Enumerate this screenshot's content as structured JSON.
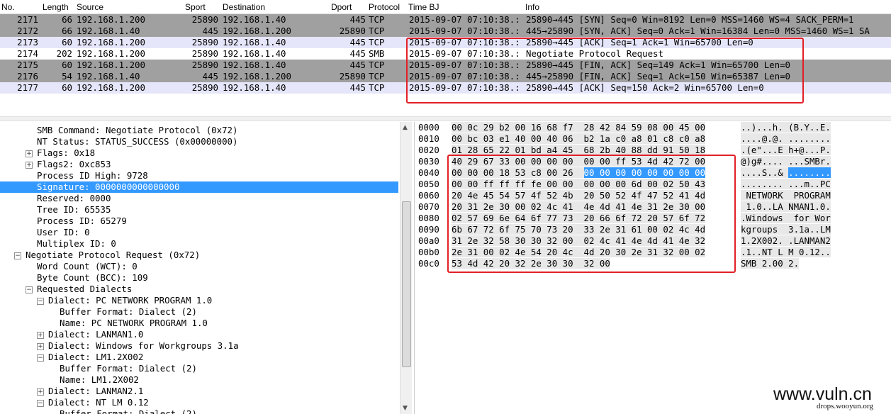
{
  "packet_list": {
    "columns": [
      "No.",
      "Length",
      "Source",
      "Sport",
      "Destination",
      "Dport",
      "Protocol",
      "Time BJ",
      "Info"
    ],
    "rows": [
      {
        "no": "2171",
        "length": "66",
        "source": "192.168.1.200",
        "sport": "25890",
        "destination": "192.168.1.40",
        "dport": "445",
        "protocol": "TCP",
        "time": "2015-09-07 07:10:38.:",
        "info": "25890→445 [SYN] Seq=0 Win=8192 Len=0 MSS=1460 WS=4 SACK_PERM=1"
      },
      {
        "no": "2172",
        "length": "66",
        "source": "192.168.1.40",
        "sport": "445",
        "destination": "192.168.1.200",
        "dport": "25890",
        "protocol": "TCP",
        "time": "2015-09-07 07:10:38.:",
        "info": "445→25890 [SYN, ACK] Seq=0 Ack=1 Win=16384 Len=0 MSS=1460 WS=1 SA"
      },
      {
        "no": "2173",
        "length": "60",
        "source": "192.168.1.200",
        "sport": "25890",
        "destination": "192.168.1.40",
        "dport": "445",
        "protocol": "TCP",
        "time": "2015-09-07 07:10:38.:",
        "info": "25890→445 [ACK] Seq=1 Ack=1 Win=65700 Len=0"
      },
      {
        "no": "2174",
        "length": "202",
        "source": "192.168.1.200",
        "sport": "25890",
        "destination": "192.168.1.40",
        "dport": "445",
        "protocol": "SMB",
        "time": "2015-09-07 07:10:38.:",
        "info": "Negotiate Protocol Request"
      },
      {
        "no": "2175",
        "length": "60",
        "source": "192.168.1.200",
        "sport": "25890",
        "destination": "192.168.1.40",
        "dport": "445",
        "protocol": "TCP",
        "time": "2015-09-07 07:10:38.:",
        "info": "25890→445 [FIN, ACK] Seq=149 Ack=1 Win=65700 Len=0"
      },
      {
        "no": "2176",
        "length": "54",
        "source": "192.168.1.40",
        "sport": "445",
        "destination": "192.168.1.200",
        "dport": "25890",
        "protocol": "TCP",
        "time": "2015-09-07 07:10:38.:",
        "info": "445→25890 [FIN, ACK] Seq=1 Ack=150 Win=65387 Len=0"
      },
      {
        "no": "2177",
        "length": "60",
        "source": "192.168.1.200",
        "sport": "25890",
        "destination": "192.168.1.40",
        "dport": "445",
        "protocol": "TCP",
        "time": "2015-09-07 07:10:38.:",
        "info": "25890→445 [ACK] Seq=150 Ack=2 Win=65700 Len=0"
      }
    ]
  },
  "detail_tree": {
    "lines": [
      {
        "text": "SMB Command: Negotiate Protocol (0x72)",
        "indent": 3,
        "toggle": ""
      },
      {
        "text": "NT Status: STATUS_SUCCESS (0x00000000)",
        "indent": 3,
        "toggle": ""
      },
      {
        "text": "Flags: 0x18",
        "indent": 3,
        "toggle": "+"
      },
      {
        "text": "Flags2: 0xc853",
        "indent": 3,
        "toggle": "+"
      },
      {
        "text": "Process ID High: 9728",
        "indent": 3,
        "toggle": ""
      },
      {
        "text": "Signature: 0000000000000000",
        "indent": 3,
        "toggle": "",
        "selected": true
      },
      {
        "text": "Reserved: 0000",
        "indent": 3,
        "toggle": ""
      },
      {
        "text": "Tree ID: 65535",
        "indent": 3,
        "toggle": ""
      },
      {
        "text": "Process ID: 65279",
        "indent": 3,
        "toggle": ""
      },
      {
        "text": "User ID: 0",
        "indent": 3,
        "toggle": ""
      },
      {
        "text": "Multiplex ID: 0",
        "indent": 3,
        "toggle": ""
      },
      {
        "text": "Negotiate Protocol Request (0x72)",
        "indent": 2,
        "toggle": "-"
      },
      {
        "text": "Word Count (WCT): 0",
        "indent": 3,
        "toggle": ""
      },
      {
        "text": "Byte Count (BCC): 109",
        "indent": 3,
        "toggle": ""
      },
      {
        "text": "Requested Dialects",
        "indent": 3,
        "toggle": "-"
      },
      {
        "text": "Dialect: PC NETWORK PROGRAM 1.0",
        "indent": 4,
        "toggle": "-"
      },
      {
        "text": "Buffer Format: Dialect (2)",
        "indent": 5,
        "toggle": ""
      },
      {
        "text": "Name: PC NETWORK PROGRAM 1.0",
        "indent": 5,
        "toggle": ""
      },
      {
        "text": "Dialect: LANMAN1.0",
        "indent": 4,
        "toggle": "+"
      },
      {
        "text": "Dialect: Windows for Workgroups 3.1a",
        "indent": 4,
        "toggle": "+"
      },
      {
        "text": "Dialect: LM1.2X002",
        "indent": 4,
        "toggle": "-"
      },
      {
        "text": "Buffer Format: Dialect (2)",
        "indent": 5,
        "toggle": ""
      },
      {
        "text": "Name: LM1.2X002",
        "indent": 5,
        "toggle": ""
      },
      {
        "text": "Dialect: LANMAN2.1",
        "indent": 4,
        "toggle": "+"
      },
      {
        "text": "Dialect: NT LM 0.12",
        "indent": 4,
        "toggle": "-"
      },
      {
        "text": "Buffer Format: Dialect (2)",
        "indent": 5,
        "toggle": ""
      }
    ]
  },
  "hex_dump": {
    "rows": [
      {
        "offset": "0000",
        "bytes": "00 0c 29 b2 00 16 68 f7  28 42 84 59 08 00 45 00",
        "ascii": "..)...h. (B.Y..E."
      },
      {
        "offset": "0010",
        "bytes": "00 bc 03 e1 40 00 40 06  b2 1a c0 a8 01 c8 c0 a8",
        "ascii": "....@.@. ........"
      },
      {
        "offset": "0020",
        "bytes": "01 28 65 22 01 bd a4 45  68 2b 40 88 dd 91 50 18",
        "ascii": ".(e\"...E h+@...P."
      },
      {
        "offset": "0030",
        "bytes": "40 29 67 33 00 00 00 00  00 00 ff 53 4d 42 72 00",
        "ascii": "@)g#.... ...SMBr."
      },
      {
        "offset": "0040",
        "bytes_pre": "00 00 00 18 53 c8 00 26  ",
        "bytes_hl": "00 00 00 00 00 00 00 00",
        "ascii_pre": "....S..& ",
        "ascii_hl": "........"
      },
      {
        "offset": "0050",
        "bytes": "00 00 ff ff ff fe 00 00  00 00 00 6d 00 02 50 43",
        "ascii": "........ ...m..PC"
      },
      {
        "offset": "0060",
        "bytes": "20 4e 45 54 57 4f 52 4b  20 50 52 4f 47 52 41 4d",
        "ascii": " NETWORK  PROGRAM"
      },
      {
        "offset": "0070",
        "bytes": "20 31 2e 30 00 02 4c 41  4e 4d 41 4e 31 2e 30 00",
        "ascii": " 1.0..LA NMAN1.0."
      },
      {
        "offset": "0080",
        "bytes": "02 57 69 6e 64 6f 77 73  20 66 6f 72 20 57 6f 72",
        "ascii": ".Windows  for Wor"
      },
      {
        "offset": "0090",
        "bytes": "6b 67 72 6f 75 70 73 20  33 2e 31 61 00 02 4c 4d",
        "ascii": "kgroups  3.1a..LM"
      },
      {
        "offset": "00a0",
        "bytes": "31 2e 32 58 30 30 32 00  02 4c 41 4e 4d 41 4e 32",
        "ascii": "1.2X002. .LANMAN2"
      },
      {
        "offset": "00b0",
        "bytes": "2e 31 00 02 4e 54 20 4c  4d 20 30 2e 31 32 00 02",
        "ascii": ".1..NT L M 0.12.."
      },
      {
        "offset": "00c0",
        "bytes": "53 4d 42 20 32 2e 30 30  32 00",
        "ascii": "SMB 2.00 2."
      }
    ]
  },
  "watermark": {
    "site": "www.vuln.cn",
    "sub": "drops.wooyun.org"
  },
  "colors": {
    "gray_row": "#a0a0a0",
    "lavender_row": "#e6e6fa",
    "selection": "#3399ff",
    "annotation_red": "#e21f26"
  }
}
